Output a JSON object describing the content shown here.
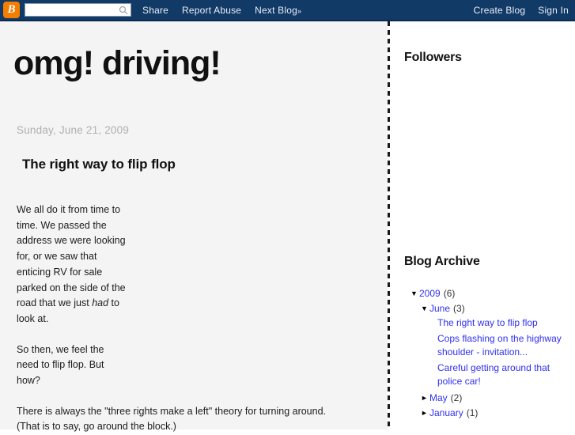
{
  "navbar": {
    "logo_icon": "blogger-b-icon",
    "logo_letter": "B",
    "search": {
      "value": "",
      "placeholder": "",
      "icon": "search-icon"
    },
    "links": [
      {
        "label": "Share"
      },
      {
        "label": "Report Abuse"
      },
      {
        "label": "Next Blog",
        "suffix": "»"
      }
    ],
    "right_links": [
      {
        "label": "Create Blog"
      },
      {
        "label": "Sign In"
      }
    ]
  },
  "blog": {
    "title": "omg! driving!"
  },
  "post": {
    "date": "Sunday, June 21, 2009",
    "title": "The right way to flip flop",
    "paragraphs": [
      "We all do it from time to time. We passed the address we were looking for, or we saw that enticing RV for sale parked on the side of the road that we just ",
      "So then, we feel the need to flip flop. But how?",
      "There is always the \"three rights make a left\" theory for turning around. (That is to say, go around the block.)"
    ],
    "italic_phrase": "had",
    "paragraph1_tail": " to look at."
  },
  "sidebar": {
    "followers": {
      "title": "Followers"
    },
    "archive": {
      "title": "Blog Archive",
      "entries": [
        {
          "toggle": "▼",
          "label": "2009",
          "count": "(6)",
          "level": "year"
        },
        {
          "toggle": "▼",
          "label": "June",
          "count": "(3)",
          "level": "month"
        },
        {
          "toggle": "►",
          "label": "May",
          "count": "(2)",
          "level": "month"
        },
        {
          "toggle": "►",
          "label": "January",
          "count": "(1)",
          "level": "month"
        }
      ],
      "posts": [
        {
          "label": "The right way to flip flop"
        },
        {
          "label": "Cops flashing on the highway shoulder - invitation..."
        },
        {
          "label": "Careful getting around that police car!"
        }
      ]
    }
  },
  "colors": {
    "navbar_bg": "#123a67",
    "logo_orange": "#f57d00",
    "link_blue": "#3030f0",
    "content_bg": "#f4f4f4",
    "sidebar_bg": "#ffffff",
    "date_gray": "#b0b0b0"
  }
}
